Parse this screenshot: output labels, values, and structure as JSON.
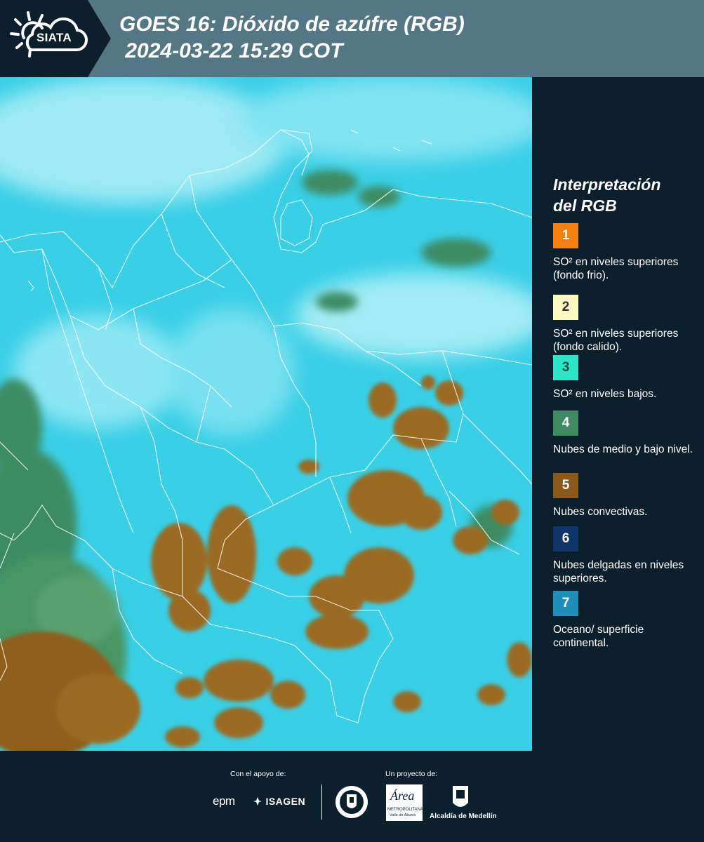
{
  "header": {
    "logo_text": "SIATA",
    "title_line1": "GOES 16: Dióxido de azúfre (RGB)",
    "title_line2": " 2024-03-22 15:29 COT"
  },
  "legend": {
    "title_line1": "Interpretación",
    "title_line2": "del RGB",
    "items": [
      {
        "number": "1",
        "label": "SO² en niveles superiores (fondo frio).",
        "color": "#f57f10",
        "text_color": "#ffffff"
      },
      {
        "number": "2",
        "label": "SO² en niveles superiores (fondo calido).",
        "color": "#fff7c0",
        "text_color": "#333333"
      },
      {
        "number": "3",
        "label": "SO² en niveles bajos.",
        "color": "#2de6c8",
        "text_color": "#1a4a44"
      },
      {
        "number": "4",
        "label": "Nubes de medio y bajo nivel.",
        "color": "#3e8b63",
        "text_color": "#ffffff"
      },
      {
        "number": "5",
        "label": "Nubes convectivas.",
        "color": "#8c5a18",
        "text_color": "#ffffff"
      },
      {
        "number": "6",
        "label": "Nubes delgadas en niveles superiores.",
        "color": "#10356a",
        "text_color": "#ffffff"
      },
      {
        "number": "7",
        "label": "Oceano/ superficie continental.",
        "color": "#1d8fb8",
        "text_color": "#ffffff"
      }
    ]
  },
  "footer": {
    "support_label": "Con el apoyo de:",
    "project_label": "Un proyecto de:",
    "sponsor1": "epm",
    "sponsor2": "ISAGEN",
    "partner1_icon": "medellin-seal-icon",
    "partner2_name": "Área",
    "partner2_sub": "METROPOLITANA",
    "partner2_sub2": "Valle de Aburrá",
    "partner3": "Alcaldía de Medellín"
  },
  "colors": {
    "header_bg": "#547785",
    "dark_bg": "#0c1f2c",
    "map_base": "#39cfe6",
    "cloud_convective": "#9a6a22",
    "cloud_low": "#3e8b63"
  }
}
